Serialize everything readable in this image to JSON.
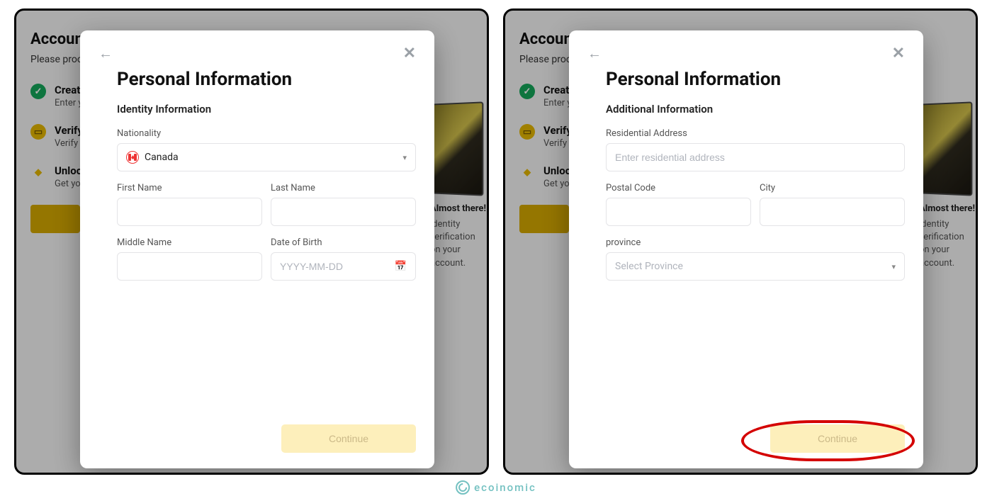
{
  "watermark": "ecoinomic",
  "bg": {
    "title": "Account",
    "subtitle": "Please proceed",
    "steps": [
      {
        "title": "Create",
        "desc": "Enter your"
      },
      {
        "title": "Verify",
        "desc": "Verify your"
      },
      {
        "title": "Unlock",
        "desc": "Get your"
      }
    ],
    "promo": {
      "almost": "Almost there!",
      "line": "identity verification on your account."
    }
  },
  "left_modal": {
    "heading": "Personal Information",
    "section": "Identity Information",
    "fields": {
      "nationality_label": "Nationality",
      "nationality_value": "Canada",
      "first_name_label": "First Name",
      "last_name_label": "Last Name",
      "middle_name_label": "Middle Name",
      "dob_label": "Date of Birth",
      "dob_placeholder": "YYYY-MM-DD"
    },
    "continue": "Continue"
  },
  "right_modal": {
    "heading": "Personal Information",
    "section": "Additional Information",
    "fields": {
      "address_label": "Residential Address",
      "address_placeholder": "Enter residential address",
      "postal_label": "Postal Code",
      "city_label": "City",
      "province_label": "province",
      "province_placeholder": "Select Province"
    },
    "continue": "Continue"
  }
}
